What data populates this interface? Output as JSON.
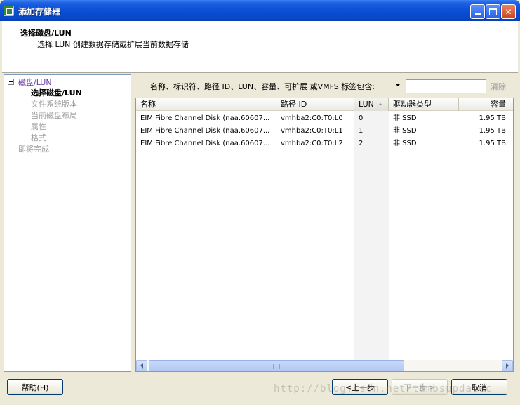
{
  "window": {
    "title": "添加存储器"
  },
  "header": {
    "title": "选择磁盘/LUN",
    "subtitle": "选择 LUN 创建数据存储或扩展当前数据存储"
  },
  "nav": {
    "group_label": "磁盘/LUN",
    "items": [
      {
        "label": "选择磁盘/LUN",
        "state": "current"
      },
      {
        "label": "文件系统版本",
        "state": "disabled"
      },
      {
        "label": "当前磁盘布局",
        "state": "disabled"
      },
      {
        "label": "属性",
        "state": "disabled"
      },
      {
        "label": "格式",
        "state": "disabled"
      }
    ],
    "finish_label": "即将完成"
  },
  "filter": {
    "label": "名称、标识符、路径 ID、LUN、容量、可扩展 或VMFS 标签包含:",
    "value": "",
    "clear_label": "清除"
  },
  "table": {
    "columns": [
      "名称",
      "路径 ID",
      "LUN",
      "驱动器类型",
      "容量"
    ],
    "sorted_column": "LUN",
    "rows": [
      {
        "name": "EIM Fibre Channel Disk (naa.60607...",
        "path_id": "vmhba2:C0:T0:L0",
        "lun": "0",
        "drive_type": "非 SSD",
        "capacity": "1.95 TB"
      },
      {
        "name": "EIM Fibre Channel Disk (naa.60607...",
        "path_id": "vmhba2:C0:T0:L1",
        "lun": "1",
        "drive_type": "非 SSD",
        "capacity": "1.95 TB"
      },
      {
        "name": "EIM Fibre Channel Disk (naa.60607...",
        "path_id": "vmhba2:C0:T0:L2",
        "lun": "2",
        "drive_type": "非 SSD",
        "capacity": "1.95 TB"
      }
    ]
  },
  "buttons": {
    "help": "帮助(H)",
    "back": "≤上一步",
    "next": "下一步 ≥",
    "cancel": "取消"
  },
  "watermark": "http://blog.csdn.net/tumbsupdatec",
  "colors": {
    "titlebar": "#0a4fd6",
    "link": "#6a3ca8",
    "disabled_text": "#a0a0a0",
    "panel_bg": "#ece9d8"
  },
  "icons": [
    "app-icon",
    "minimize-icon",
    "maximize-icon",
    "close-icon",
    "tree-collapse-icon",
    "dropdown-arrow-icon",
    "sort-ascending-icon",
    "scroll-left-icon",
    "scroll-right-icon"
  ]
}
